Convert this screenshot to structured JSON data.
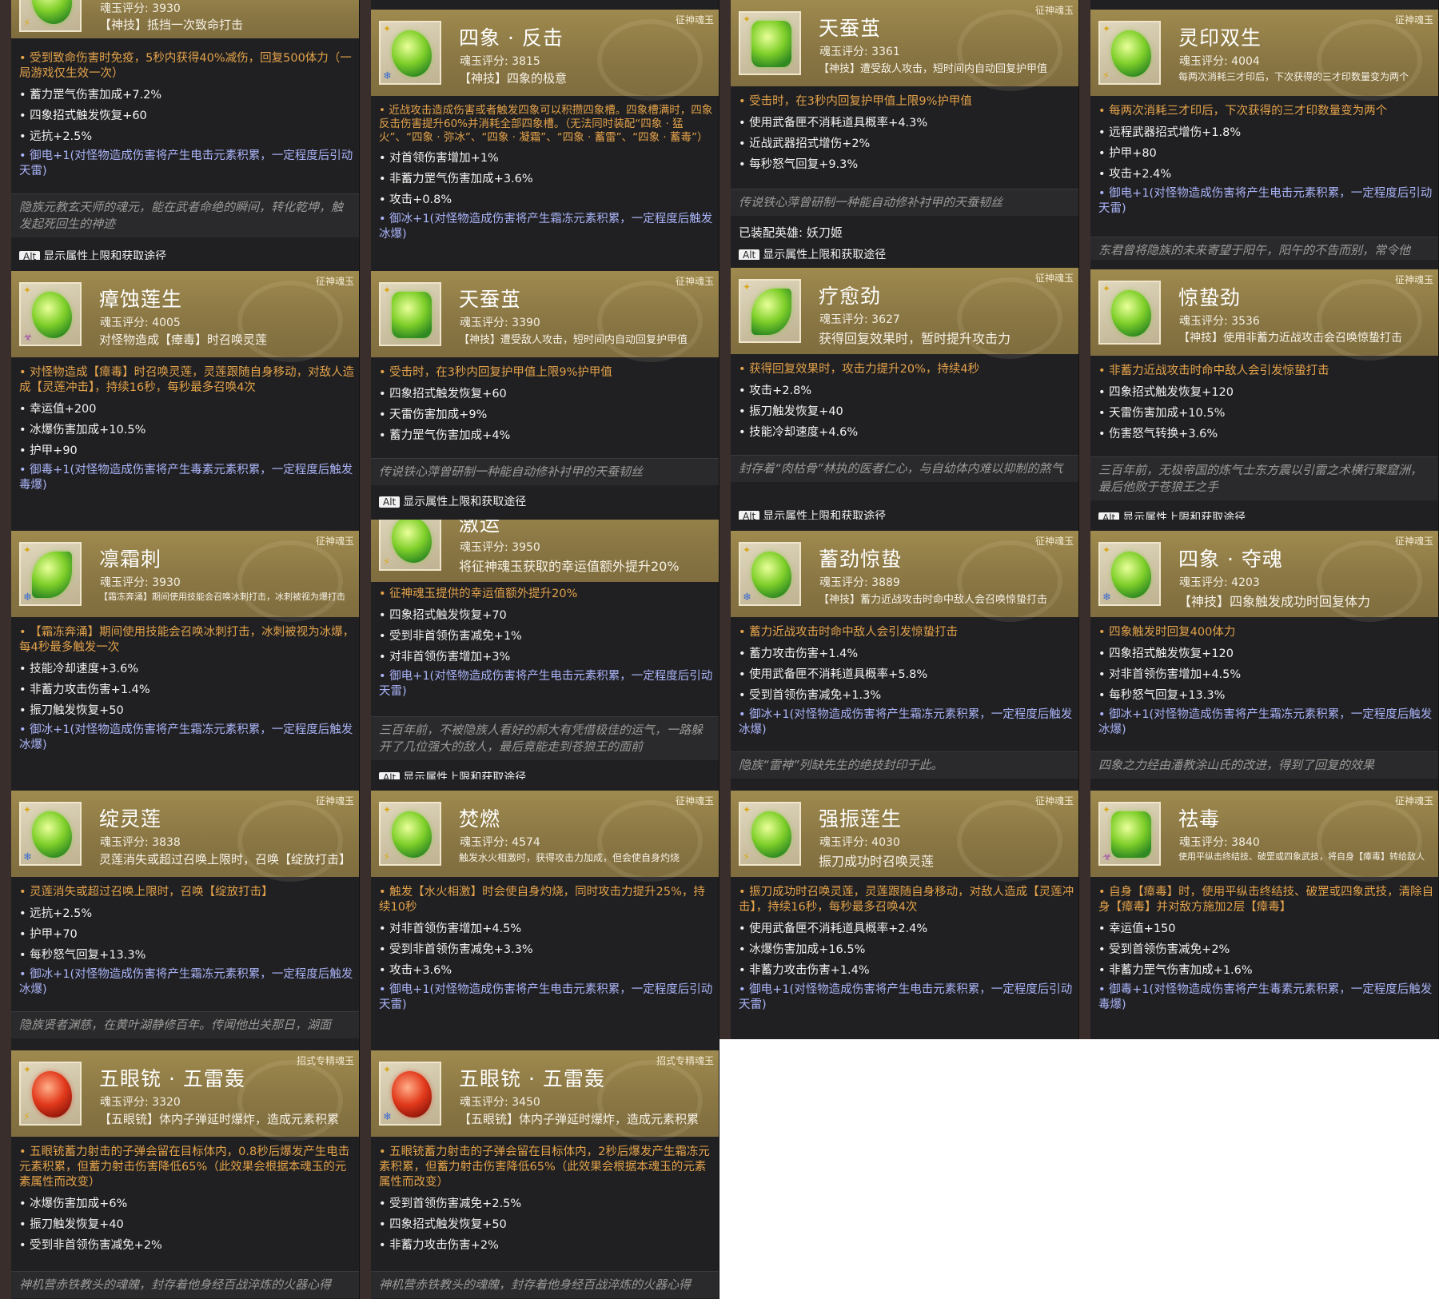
{
  "common": {
    "tag_soul": "征神魂玉",
    "tag_special": "招式专精魂玉",
    "alt_key": "Alt",
    "alt_text": "显示属性上限和获取途径",
    "equipped_label": "已装配英雄: 妖刀姬"
  },
  "cards": [
    {
      "name": "",
      "score": "魂玉评分: 3930",
      "skill": "【神技】抵挡一次致命打击",
      "lead": "受到致命伤害时免疫，5秒内获得40%减伤，回复500体力（一局游戏仅生效一次）",
      "stats": [
        "蓄力罡气伤害加成+7.2%",
        "四象招式触发恢复+60",
        "远抗+2.5%"
      ],
      "element": "御电+1(对怪物造成伤害将产生电击元素积累，一定程度后引动天雷)",
      "lore": "隐族元教玄天师的魂元，能在武者命绝的瞬间，转化乾坤，触发起死回生的神迹",
      "badge": "lightning"
    },
    {
      "name": "四象 · 反击",
      "score": "魂玉评分: 3815",
      "skill": "【神技】四象的极意",
      "lead": "近战攻击造成伤害或者触发四象可以积攒四象槽。四象槽满时，四象反击伤害提升60%并消耗全部四象槽。（无法同时装配“四象 · 猛火”、“四象 · 弥冰”、“四象 · 凝霜”、“四象 · 蓄雷”、“四象 · 蓄毒”）",
      "stats": [
        "对首领伤害增加+1%",
        "非蓄力罡气伤害加成+3.6%",
        "攻击+0.8%"
      ],
      "element": "御冰+1(对怪物造成伤害将产生霜冻元素积累，一定程度后触发冰爆)",
      "lore": "",
      "badge": "frost"
    },
    {
      "name": "天蚕茧",
      "score": "魂玉评分: 3361",
      "skill": "【神技】遭受敌人攻击，短时间内自动回复护甲值",
      "lead": "受击时，在3秒内回复护甲值上限9%护甲值",
      "stats": [
        "使用武备匣不消耗道具概率+4.3%",
        "近战武器招式增伤+2%",
        "每秒怒气回复+9.3%"
      ],
      "element": "",
      "lore": "传说铁心萍曾研制一种能自动修补衬甲的天蚕韧丝",
      "badge": ""
    },
    {
      "name": "灵印双生",
      "score": "魂玉评分: 4004",
      "skill": "每两次消耗三才印后，下次获得的三才印数量变为两个",
      "lead": "每两次消耗三才印后，下次获得的三才印数量变为两个",
      "stats": [
        "远程武器招式增伤+1.8%",
        "护甲+80",
        "攻击+2.4%"
      ],
      "element": "御电+1(对怪物造成伤害将产生电击元素积累，一定程度后引动天雷)",
      "lore": "东君曾将隐族的未来寄望于阳午，阳午的不告而别，常令他",
      "badge": "lightning"
    },
    {
      "name": "瘴蚀莲生",
      "score": "魂玉评分: 4005",
      "skill": "对怪物造成【瘴毒】时召唤灵莲",
      "lead": "对怪物造成【瘴毒】时召唤灵莲，灵莲跟随自身移动，对敌人造成【灵莲冲击】，持续16秒，每秒最多召唤4次",
      "stats": [
        "幸运值+200",
        "冰爆伤害加成+10.5%",
        "护甲+90"
      ],
      "element": "御毒+1(对怪物造成伤害将产生毒素元素积累，一定程度后触发毒爆)",
      "lore": "",
      "badge": "poison"
    },
    {
      "name": "天蚕茧",
      "score": "魂玉评分: 3390",
      "skill": "【神技】遭受敌人攻击，短时间内自动回复护甲值",
      "lead": "受击时，在3秒内回复护甲值上限9%护甲值",
      "stats": [
        "四象招式触发恢复+60",
        "天雷伤害加成+9%",
        "蓄力罡气伤害加成+4%"
      ],
      "element": "",
      "lore": "传说铁心萍曾研制一种能自动修补衬甲的天蚕韧丝",
      "badge": ""
    },
    {
      "name": "疗愈劲",
      "score": "魂玉评分: 3627",
      "skill": "获得回复效果时，暂时提升攻击力",
      "lead": "获得回复效果时，攻击力提升20%，持续4秒",
      "stats": [
        "攻击+2.8%",
        "振刀触发恢复+40",
        "技能冷却速度+4.6%"
      ],
      "element": "",
      "lore": "封存着“肉枯骨”林执的医者仁心，与自幼体内难以抑制的煞气",
      "badge": ""
    },
    {
      "name": "惊蛰劲",
      "score": "魂玉评分: 3536",
      "skill": "【神技】使用非蓄力近战攻击会召唤惊蛰打击",
      "lead": "非蓄力近战攻击时命中敌人会引发惊蛰打击",
      "stats": [
        "四象招式触发恢复+120",
        "天雷伤害加成+10.5%",
        "伤害怒气转换+3.6%"
      ],
      "element": "",
      "lore": "三百年前，无极帝国的炼气士东方震以引雷之术横行聚窟洲，最后他败于苍狼王之手",
      "badge": ""
    },
    {
      "name": "凛霜刺",
      "score": "魂玉评分: 3930",
      "skill": "【霜冻奔涌】期间使用技能会召唤冰刺打击，冰刺被视为爆打击",
      "lead": "【霜冻奔涌】期间使用技能会召唤冰刺打击，冰刺被视为冰爆，每4秒最多触发一次",
      "stats": [
        "技能冷却速度+3.6%",
        "非蓄力攻击伤害+1.4%",
        "振刀触发恢复+50"
      ],
      "element": "御冰+1(对怪物造成伤害将产生霜冻元素积累，一定程度后触发冰爆)",
      "lore": "",
      "badge": "frost"
    },
    {
      "name": "激运",
      "score": "魂玉评分: 3950",
      "skill": "将征神魂玉获取的幸运值额外提升20%",
      "lead": "征神魂玉提供的幸运值额外提升20%",
      "stats": [
        "四象招式触发恢复+70",
        "受到非首领伤害减免+1%",
        "对非首领伤害增加+3%"
      ],
      "element": "御电+1(对怪物造成伤害将产生电击元素积累，一定程度后引动天雷)",
      "lore": "三百年前，不被隐族人看好的郝大有凭借极佳的运气，一路躲开了几位强大的敌人，最后竟能走到苍狼王的面前",
      "badge": "lightning"
    },
    {
      "name": "蓄劲惊蛰",
      "score": "魂玉评分: 3889",
      "skill": "【神技】蓄力近战攻击时命中敌人会召唤惊蛰打击",
      "lead": "蓄力近战攻击时命中敌人会引发惊蛰打击",
      "stats": [
        "蓄力攻击伤害+1.4%",
        "使用武备匣不消耗道具概率+5.8%",
        "受到首领伤害减免+1.3%"
      ],
      "element": "御冰+1(对怪物造成伤害将产生霜冻元素积累，一定程度后触发冰爆)",
      "lore": "隐族“雷神”列缺先生的绝技封印于此。",
      "badge": "frost"
    },
    {
      "name": "四象 · 夺魂",
      "score": "魂玉评分: 4203",
      "skill": "【神技】四象触发成功时回复体力",
      "lead": "四象触发时回复400体力",
      "stats": [
        "四象招式触发恢复+120",
        "对非首领伤害增加+4.5%",
        "每秒怒气回复+13.3%"
      ],
      "element": "御冰+1(对怪物造成伤害将产生霜冻元素积累，一定程度后触发冰爆)",
      "lore": "四象之力经由潘教涂山氏的改进，得到了回复的效果",
      "badge": "frost"
    },
    {
      "name": "绽灵莲",
      "score": "魂玉评分: 3838",
      "skill": "灵莲消失或超过召唤上限时，召唤【绽放打击】",
      "lead": "灵莲消失或超过召唤上限时，召唤【绽放打击】",
      "stats": [
        "远抗+2.5%",
        "护甲+70",
        "每秒怒气回复+13.3%"
      ],
      "element": "御冰+1(对怪物造成伤害将产生霜冻元素积累，一定程度后触发冰爆)",
      "lore": "隐族贤者渊慈，在黄叶湖静修百年。传闻他出关那日，湖面",
      "badge": "frost"
    },
    {
      "name": "焚燃",
      "score": "魂玉评分: 4574",
      "skill": "触发水火相激时，获得攻击力加成，但会使自身灼烧",
      "lead": "触发【水火相激】时会使自身灼烧，同时攻击力提升25%，持续10秒",
      "stats": [
        "对非首领伤害增加+4.5%",
        "受到非首领伤害减免+3.3%",
        "攻击+3.6%"
      ],
      "element": "御电+1(对怪物造成伤害将产生电击元素积累，一定程度后引动天雷)",
      "lore": "",
      "badge": "lightning"
    },
    {
      "name": "强振莲生",
      "score": "魂玉评分: 4030",
      "skill": "振刀成功时召唤灵莲",
      "lead": "振刀成功时召唤灵莲，灵莲跟随自身移动，对敌人造成【灵莲冲击】，持续16秒，每秒最多召唤4次",
      "stats": [
        "使用武备匣不消耗道具概率+2.4%",
        "冰爆伤害加成+16.5%",
        "非蓄力攻击伤害+1.4%"
      ],
      "element": "御电+1(对怪物造成伤害将产生电击元素积累，一定程度后引动天雷)",
      "lore": "",
      "badge": "lightning"
    },
    {
      "name": "祛毒",
      "score": "魂玉评分: 3840",
      "skill": "使用平纵击终结技、破罡或四象武技，将自身【瘴毒】转给敌人",
      "lead": "自身【瘴毒】时，使用平纵击终结技、破罡或四象武技，清除自身【瘴毒】并对敌方施加2层【瘴毒】",
      "stats": [
        "幸运值+150",
        "受到首领伤害减免+2%",
        "非蓄力罡气伤害加成+1.6%"
      ],
      "element": "御毒+1(对怪物造成伤害将产生毒素元素积累，一定程度后触发毒爆)",
      "lore": "",
      "badge": "poison"
    },
    {
      "name": "五眼铳 · 五雷轰",
      "score": "魂玉评分: 3320",
      "skill": "【五眼铳】体内子弹延时爆炸，造成元素积累",
      "lead": "五眼铳蓄力射击的子弹会留在目标体内，0.8秒后爆发产生电击元素积累，但蓄力射击伤害降低65%（此效果会根据本魂玉的元素属性而改变）",
      "stats": [
        "冰爆伤害加成+6%",
        "振刀触发恢复+40",
        "受到非首领伤害减免+2%"
      ],
      "element": "",
      "lore": "神机营赤铁教头的魂魄，封存着他身经百战淬炼的火器心得",
      "badge": "lightning"
    },
    {
      "name": "五眼铳 · 五雷轰",
      "score": "魂玉评分: 3450",
      "skill": "【五眼铳】体内子弹延时爆炸，造成元素积累",
      "lead": "五眼铳蓄力射击的子弹会留在目标体内，2秒后爆发产生霜冻元素积累，但蓄力射击伤害降低65%（此效果会根据本魂玉的元素属性而改变）",
      "stats": [
        "受到首领伤害减免+2.5%",
        "四象招式触发恢复+50",
        "非蓄力攻击伤害+2%"
      ],
      "element": "",
      "lore": "神机营赤铁教头的魂魄，封存着他身经百战淬炼的火器心得",
      "badge": "frost"
    }
  ]
}
